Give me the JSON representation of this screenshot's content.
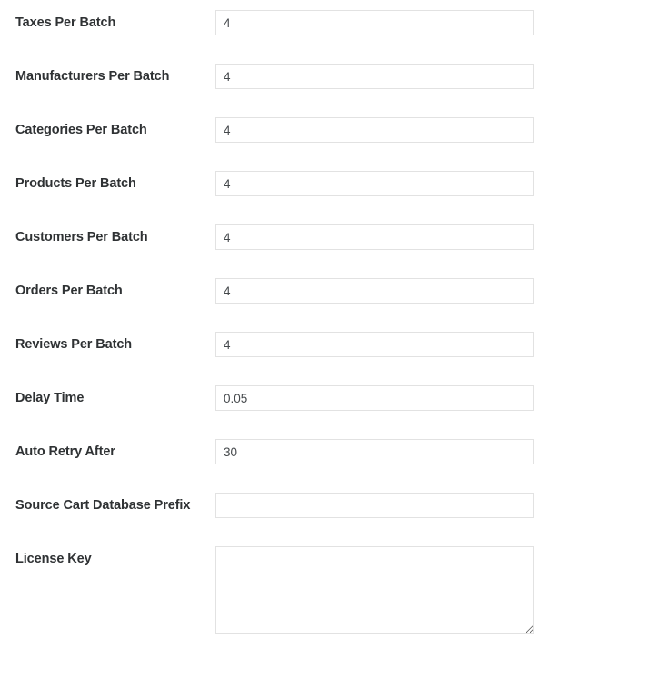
{
  "form": {
    "fields": [
      {
        "label": "Taxes Per Batch",
        "name": "taxes-per-batch",
        "type": "text",
        "value": "4",
        "placeholder": ""
      },
      {
        "label": "Manufacturers Per Batch",
        "name": "manufacturers-per-batch",
        "type": "text",
        "value": "4",
        "placeholder": ""
      },
      {
        "label": "Categories Per Batch",
        "name": "categories-per-batch",
        "type": "text",
        "value": "4",
        "placeholder": ""
      },
      {
        "label": "Products Per Batch",
        "name": "products-per-batch",
        "type": "text",
        "value": "4",
        "placeholder": ""
      },
      {
        "label": "Customers Per Batch",
        "name": "customers-per-batch",
        "type": "text",
        "value": "4",
        "placeholder": ""
      },
      {
        "label": "Orders Per Batch",
        "name": "orders-per-batch",
        "type": "text",
        "value": "4",
        "placeholder": ""
      },
      {
        "label": "Reviews Per Batch",
        "name": "reviews-per-batch",
        "type": "text",
        "value": "4",
        "placeholder": ""
      },
      {
        "label": "Delay Time",
        "name": "delay-time",
        "type": "text",
        "value": "0.05",
        "placeholder": ""
      },
      {
        "label": "Auto Retry After",
        "name": "auto-retry-after",
        "type": "text",
        "value": "30",
        "placeholder": ""
      },
      {
        "label": "Source Cart Database Prefix",
        "name": "source-cart-database-prefix",
        "type": "text",
        "value": "",
        "placeholder": ""
      },
      {
        "label": "License Key",
        "name": "license-key",
        "type": "textarea",
        "value": "",
        "placeholder": ""
      }
    ]
  },
  "colors": {
    "label_text": "#2f3234",
    "input_text": "#45494c",
    "input_border": "#e2e2e2",
    "background": "#ffffff"
  }
}
